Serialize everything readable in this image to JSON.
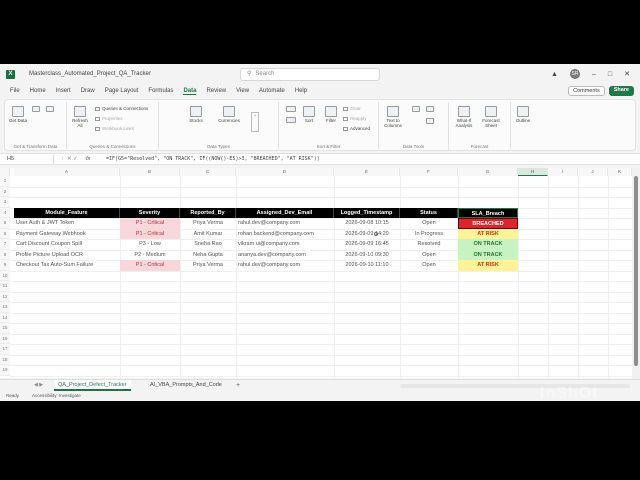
{
  "window": {
    "doc_title": "Masterclass_Automated_Project_QA_Tracker",
    "search_placeholder": "Search",
    "avatar_initials": "SR"
  },
  "menu": [
    "File",
    "Home",
    "Insert",
    "Draw",
    "Page Layout",
    "Formulas",
    "Data",
    "Review",
    "View",
    "Automate",
    "Help"
  ],
  "menu_active": "Data",
  "buttons": {
    "comments": "Comments",
    "share": "Share"
  },
  "ribbon": {
    "get_data": "Get Data",
    "get_transform_group": "Get & Transform Data",
    "refresh_all": "Refresh All",
    "queries_connections": "Queries & Connections",
    "properties": "Properties",
    "workbook_links": "Workbook Links",
    "queries_group": "Queries & Connections",
    "stocks": "Stocks",
    "currencies": "Currencies",
    "data_types_group": "Data Types",
    "sort": "Sort",
    "filter": "Filter",
    "clear": "Clear",
    "reapply": "Reapply",
    "advanced": "Advanced",
    "sort_filter_group": "Sort & Filter",
    "text_to_columns": "Text to Columns",
    "data_tools_group": "Data Tools",
    "what_if": "What-If Analysis",
    "forecast_sheet": "Forecast Sheet",
    "forecast_group": "Forecast",
    "outline": "Outline"
  },
  "formula_bar": {
    "name_box": "H5",
    "formula": "=IF(G5=\"Resolved\", \"ON TRACK\", IF((NOW()-E5)>3, \"BREACHED\", \"AT RISK\"))"
  },
  "columns": [
    "A",
    "B",
    "C",
    "D",
    "E",
    "F",
    "G",
    "H",
    "I",
    "J",
    "K"
  ],
  "row_numbers": [
    "1",
    "2",
    "3",
    "4",
    "5",
    "6",
    "7",
    "8",
    "9",
    "10",
    "11",
    "12",
    "13",
    "14",
    "15",
    "16",
    "17",
    "18",
    "19"
  ],
  "table": {
    "headers": [
      "Module_Feature",
      "Severity",
      "Reported_By",
      "Assigned_Dev_Email",
      "Logged_Timestamp",
      "Status",
      "SLA_Breach"
    ],
    "rows": [
      [
        "User Auth & JWT Token",
        "P1 - Critical",
        "Priya Verma",
        "rahul.dev@company.com",
        "2026-09-08 10:15",
        "Open",
        "BREACHED"
      ],
      [
        "Payment Gateway Webhook",
        "P1 - Critical",
        "Amit Kumar",
        "rohan.backend@company.com",
        "2026-09-09 14:20",
        "In Progress",
        "AT RISK"
      ],
      [
        "Cart Discount Coupon Spill",
        "P3 - Low",
        "Sneha Rao",
        "vikram.ui@company.com",
        "2026-09-09 16:45",
        "Resolved",
        "ON TRACK"
      ],
      [
        "Profile Picture Upload OCR",
        "P2 - Medium",
        "Neha Gupta",
        "ananya.dev@company.com",
        "2026-09-10 09:30",
        "Open",
        "ON TRACK"
      ],
      [
        "Checkout Tax Auto-Sum Failure",
        "P1 - Critical",
        "Priya Verma",
        "rahul.dev@company.com",
        "2026-09-10 11:10",
        "Open",
        "AT RISK"
      ]
    ]
  },
  "sheets": [
    "QA_Project_Defect_Tracker",
    "AI_VBA_Prompts_And_Code"
  ],
  "sheet_active": "QA_Project_Defect_Tracker",
  "status": {
    "ready": "Ready",
    "accessibility": "Accessibility: Investigate"
  },
  "watermark": "InShOt",
  "colors": {
    "accent": "#217346",
    "breached": "#d9262c",
    "at_risk": "#fff39a",
    "on_track": "#c9f2c1"
  }
}
